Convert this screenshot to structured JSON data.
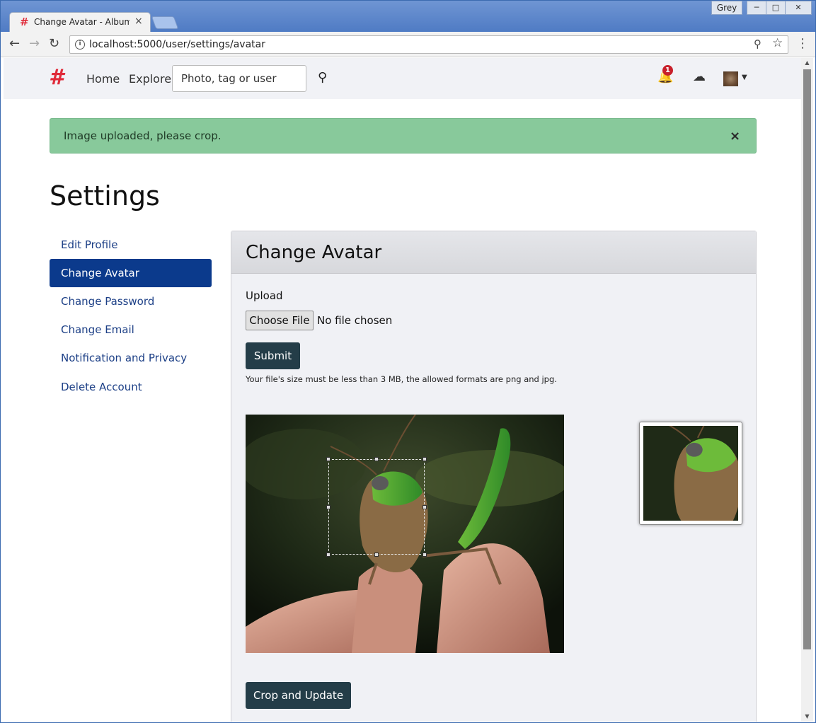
{
  "browser": {
    "tab_title": "Change Avatar - Album",
    "tab_favicon": "#",
    "profile_name": "Grey",
    "url": "localhost:5000/user/settings/avatar",
    "icons": [
      "back-icon",
      "forward-icon",
      "reload-icon",
      "info-icon",
      "zoom-icon",
      "star-icon",
      "menu-icon"
    ]
  },
  "navbar": {
    "brand": "#",
    "home_label": "Home",
    "explore_label": "Explore",
    "search_placeholder": "Photo, tag or user",
    "notification_count": "1",
    "icons": [
      "search-icon",
      "bell-icon",
      "upload-icon",
      "avatar",
      "caret-down-icon"
    ]
  },
  "alert": {
    "message": "Image uploaded, please crop.",
    "close": "×"
  },
  "page": {
    "title": "Settings"
  },
  "sidebar": {
    "items": [
      {
        "label": "Edit Profile",
        "active": false
      },
      {
        "label": "Change Avatar",
        "active": true
      },
      {
        "label": "Change Password",
        "active": false
      },
      {
        "label": "Change Email",
        "active": false
      },
      {
        "label": "Notification and Privacy",
        "active": false
      },
      {
        "label": "Delete Account",
        "active": false
      }
    ]
  },
  "card": {
    "title": "Change Avatar",
    "upload_label": "Upload",
    "choose_file_label": "Choose File",
    "file_status": "No file chosen",
    "submit_label": "Submit",
    "help_text": "Your file's size must be less than 3 MB, the allowed formats are png and jpg.",
    "crop_update_label": "Crop and Update"
  },
  "colors": {
    "primary": "#0b3a8c",
    "button_dark": "#243d48",
    "alert_bg": "#88c99b",
    "brand": "#e02b3a",
    "badge": "#c8202b"
  }
}
